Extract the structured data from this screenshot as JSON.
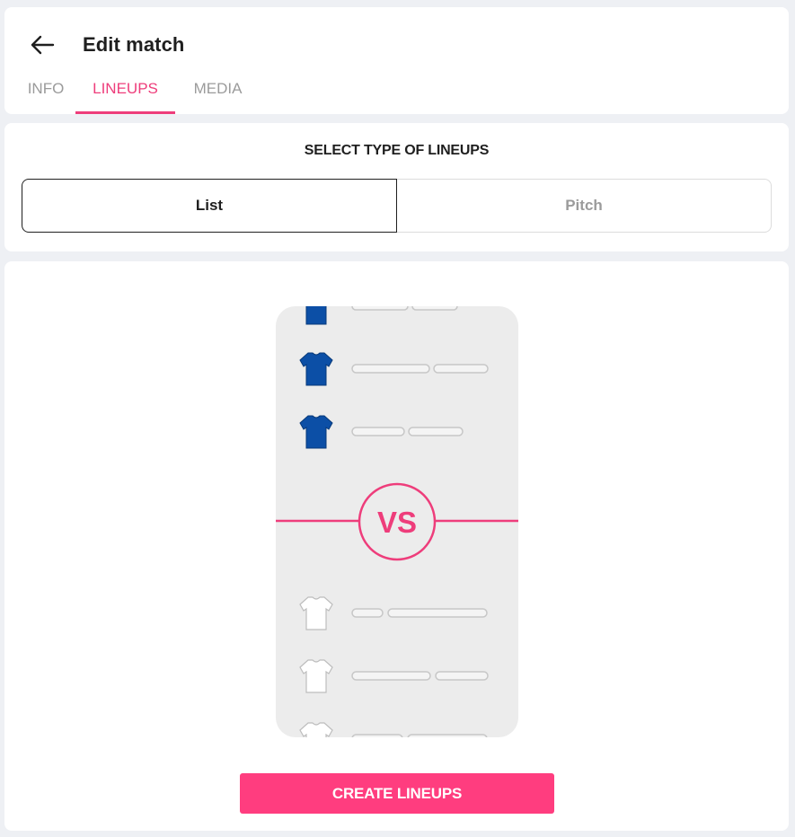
{
  "header": {
    "title": "Edit match",
    "back_icon": "arrow-left-icon"
  },
  "tabs": [
    {
      "label": "INFO",
      "active": false
    },
    {
      "label": "LINEUPS",
      "active": true
    },
    {
      "label": "MEDIA",
      "active": false
    }
  ],
  "lineup_type": {
    "title": "SELECT TYPE OF LINEUPS",
    "options": [
      {
        "label": "List",
        "selected": true
      },
      {
        "label": "Pitch",
        "selected": false
      }
    ]
  },
  "preview": {
    "vs_label": "VS",
    "home_shirt_color": "#0c4fa6",
    "away_shirt_color": "#ffffff",
    "accent_color": "#ee3d7b"
  },
  "actions": {
    "create_label": "CREATE LINEUPS"
  },
  "colors": {
    "accent": "#ee3d7b",
    "button": "#ff3d7f"
  }
}
